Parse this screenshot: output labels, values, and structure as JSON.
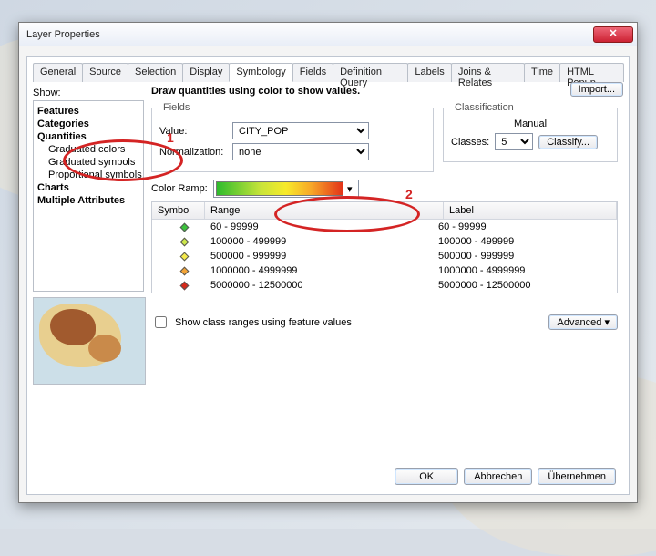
{
  "window": {
    "title": "Layer Properties"
  },
  "tabs": [
    "General",
    "Source",
    "Selection",
    "Display",
    "Symbology",
    "Fields",
    "Definition Query",
    "Labels",
    "Joins & Relates",
    "Time",
    "HTML Popup"
  ],
  "active_tab_index": 4,
  "sidebar": {
    "label": "Show:",
    "tree": {
      "features": "Features",
      "categories": "Categories",
      "quantities": "Quantities",
      "q_children": [
        "Graduated colors",
        "Graduated symbols",
        "Proportional symbols"
      ],
      "charts": "Charts",
      "multi_attr": "Multiple Attributes"
    }
  },
  "main": {
    "heading": "Draw quantities using color to show values.",
    "import": "Import...",
    "fields_group": "Fields",
    "value_lbl": "Value:",
    "value_sel": "CITY_POP",
    "norm_lbl": "Normalization:",
    "norm_sel": "none",
    "class_group": "Classification",
    "class_method": "Manual",
    "classes_lbl": "Classes:",
    "classes_sel": "5",
    "classify_btn": "Classify...",
    "ramp_lbl": "Color Ramp:",
    "grid_headers": {
      "symbol": "Symbol",
      "range": "Range",
      "label": "Label"
    },
    "rows": [
      {
        "color": "#3bc23b",
        "range": "60 - 99999",
        "label": "60 - 99999"
      },
      {
        "color": "#cde84a",
        "range": "100000 - 499999",
        "label": "100000 - 499999"
      },
      {
        "color": "#f5ea4a",
        "range": "500000 - 999999",
        "label": "500000 - 999999"
      },
      {
        "color": "#f4a435",
        "range": "1000000 - 4999999",
        "label": "1000000 - 4999999"
      },
      {
        "color": "#d6291a",
        "range": "5000000 - 12500000",
        "label": "5000000 - 12500000"
      }
    ],
    "chk_label": "Show class ranges using feature values",
    "advanced": "Advanced"
  },
  "buttons": {
    "ok": "OK",
    "cancel": "Abbrechen",
    "apply": "Übernehmen"
  },
  "annotations": {
    "n1": "1",
    "n2": "2"
  }
}
